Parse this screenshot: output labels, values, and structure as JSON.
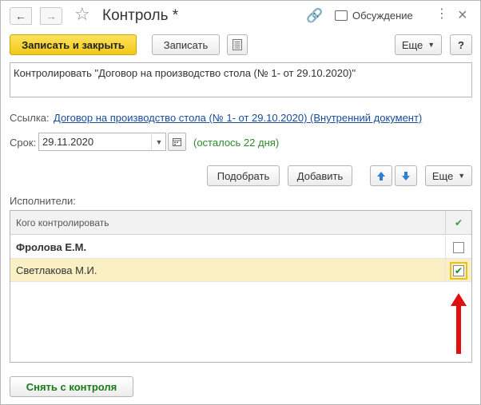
{
  "window": {
    "title": "Контроль *",
    "discussion_label": "Обсуждение"
  },
  "toolbar": {
    "save_close_label": "Записать и закрыть",
    "save_label": "Записать",
    "more_label": "Еще",
    "help_label": "?"
  },
  "content": {
    "text": "Контролировать \"Договор на производство стола (№ 1- от 29.10.2020)\""
  },
  "reference": {
    "label": "Ссылка:",
    "link_text": "Договор на производство стола (№ 1- от 29.10.2020) (Внутренний документ)"
  },
  "deadline": {
    "label": "Срок:",
    "value": "29.11.2020",
    "remaining": "(осталось 22 дня)"
  },
  "table_toolbar": {
    "pick_label": "Подобрать",
    "add_label": "Добавить",
    "more_label": "Еще"
  },
  "executors": {
    "label": "Исполнители:",
    "column_header": "Кого контролировать",
    "rows": [
      {
        "name": "Фролова Е.М.",
        "checked": false
      },
      {
        "name": "Светлакова М.И.",
        "checked": true
      }
    ]
  },
  "footer": {
    "remove_control_label": "Снять с контроля"
  },
  "colors": {
    "primary_button": "#f3c917",
    "selected_row": "#fbefc4",
    "link": "#1a4b99",
    "remaining_text": "#2a8a2a",
    "annotation_arrow": "#e01010"
  }
}
